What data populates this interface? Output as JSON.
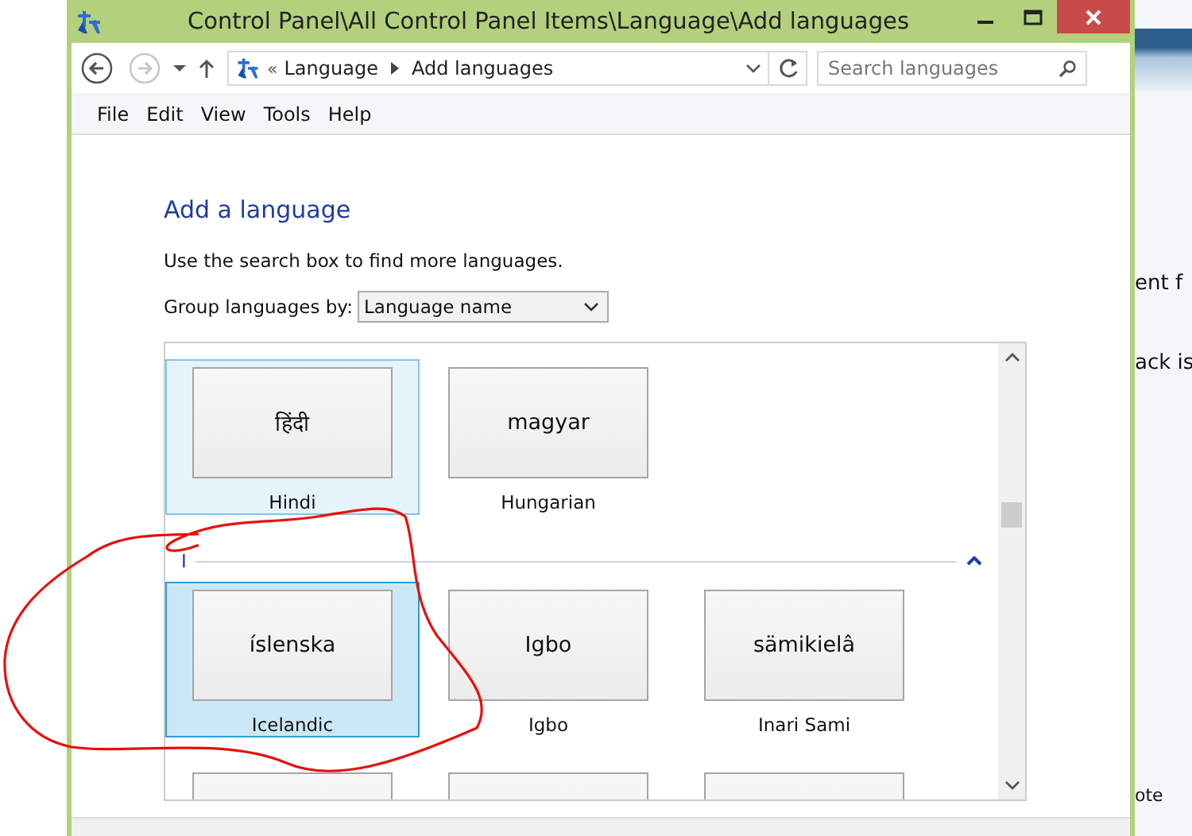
{
  "window": {
    "title": "Control Panel\\All Control Panel Items\\Language\\Add languages"
  },
  "address_bar": {
    "prefix": "«",
    "crumbs": [
      "Language",
      "Add languages"
    ]
  },
  "search": {
    "placeholder": "Search languages"
  },
  "menu": [
    "File",
    "Edit",
    "View",
    "Tools",
    "Help"
  ],
  "page": {
    "heading": "Add a language",
    "description": "Use the search box to find more languages.",
    "group_by": {
      "label": "Group languages by:",
      "value": "Language name"
    }
  },
  "groups": [
    {
      "tiles": [
        {
          "kind": "language",
          "native": "हिंदी",
          "name": "Hindi",
          "selected": false,
          "hovered": true
        },
        {
          "kind": "language",
          "native": "magyar",
          "name": "Hungarian",
          "selected": false,
          "hovered": false
        }
      ]
    },
    {
      "letter": "I",
      "tiles": [
        {
          "kind": "language",
          "native": "íslenska",
          "name": "Icelandic",
          "selected": true,
          "hovered": false
        },
        {
          "kind": "language",
          "native": "Igbo",
          "name": "Igbo",
          "selected": false,
          "hovered": false
        },
        {
          "kind": "language",
          "native": "sämikielâ",
          "name": "Inari Sami",
          "selected": false,
          "hovered": false
        },
        {
          "kind": "cut_off",
          "selected": false,
          "hovered": false
        },
        {
          "kind": "cut_off",
          "selected": false,
          "hovered": false
        },
        {
          "kind": "cut_off",
          "selected": false,
          "hovered": false
        }
      ]
    }
  ],
  "background_page": {
    "texts": [
      "ent f",
      "ack is",
      "ote"
    ]
  }
}
